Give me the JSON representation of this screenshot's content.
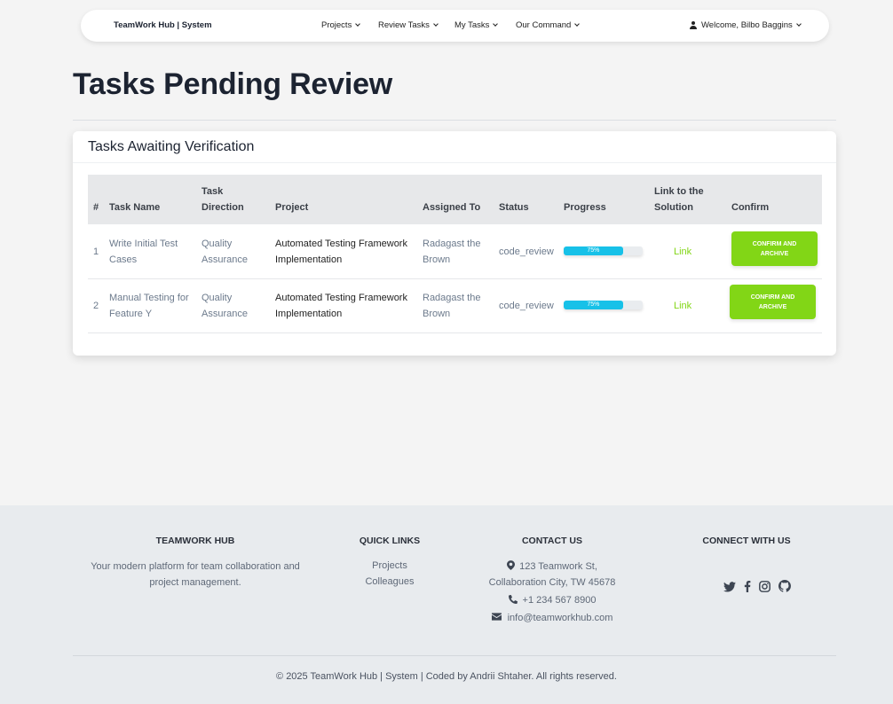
{
  "navbar": {
    "brand": "TeamWork Hub | System",
    "items": [
      {
        "label": "Projects"
      },
      {
        "label": "Review Tasks"
      },
      {
        "label": "My Tasks"
      },
      {
        "label": "Our Command"
      }
    ],
    "user_label": "Welcome, Bilbo Baggins"
  },
  "page": {
    "title": "Tasks Pending Review"
  },
  "card": {
    "title": "Tasks Awaiting Verification",
    "columns": [
      "#",
      "Task Name",
      "Task Direction",
      "Project",
      "Assigned To",
      "Status",
      "Progress",
      "Link to the Solution",
      "Confirm"
    ],
    "rows": [
      {
        "num": "1",
        "task_name": "Write Initial Test Cases",
        "direction": "Quality Assurance",
        "project": "Automated Testing Framework Implementation",
        "assigned_to": "Radagast the Brown",
        "status": "code_review",
        "progress": 75,
        "progress_label": "75%",
        "link_label": "Link",
        "confirm_label": "Confirm and Archive"
      },
      {
        "num": "2",
        "task_name": "Manual Testing for Feature Y",
        "direction": "Quality Assurance",
        "project": "Automated Testing Framework Implementation",
        "assigned_to": "Radagast the Brown",
        "status": "code_review",
        "progress": 75,
        "progress_label": "75%",
        "link_label": "Link",
        "confirm_label": "Confirm and Archive"
      }
    ]
  },
  "footer": {
    "about": {
      "heading": "TeamWork Hub",
      "text": "Your modern platform for team collaboration and project management."
    },
    "quick_links": {
      "heading": "Quick Links",
      "links": [
        "Projects",
        "Colleagues"
      ]
    },
    "contact": {
      "heading": "Contact Us",
      "address_line1": "123 Teamwork St,",
      "address_line2": "Collaboration City, TW 45678",
      "phone": "+1 234 567 8900",
      "email": "info@teamworkhub.com"
    },
    "connect": {
      "heading": "Connect With Us",
      "icons": [
        "twitter-icon",
        "facebook-icon",
        "instagram-icon",
        "github-icon"
      ]
    },
    "copyright": "© 2025 TeamWork Hub | System | Coded by Andrii Shtaher. All rights reserved."
  },
  "colors": {
    "accent_green": "#82d616",
    "progress_cyan": "#17c1e8",
    "heading_dark": "#1c2331"
  }
}
